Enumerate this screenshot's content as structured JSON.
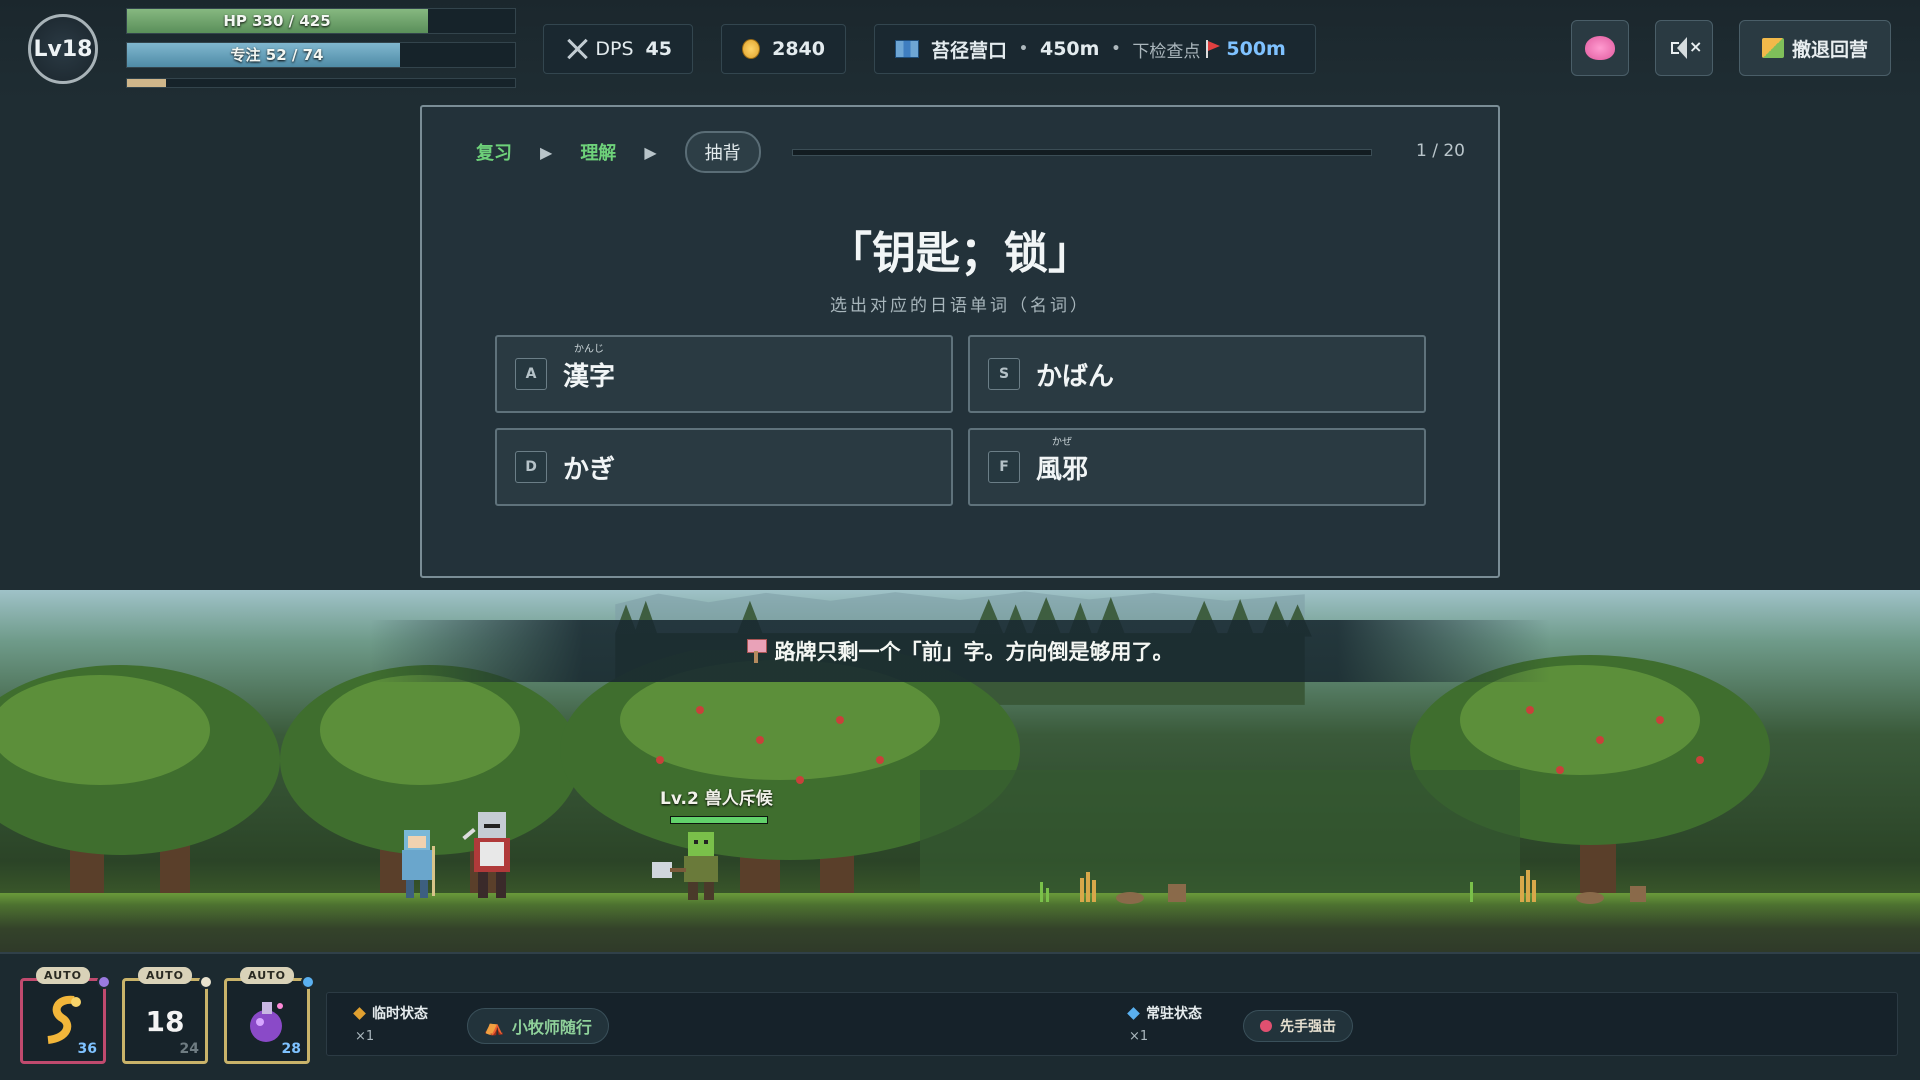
{
  "player": {
    "level": "Lv18",
    "hp_text": "HP 330 / 425",
    "hp_fraction": 0.776,
    "focus_text": "专注 52 / 74",
    "focus_fraction": 0.703,
    "xp_fraction": 0.1
  },
  "hud": {
    "dps_label": "DPS",
    "dps_value": "45",
    "gold": "2840",
    "location": "苔径营口",
    "distance": "450m",
    "next_checkpoint_label": "下检查点",
    "next_checkpoint_distance": "500m",
    "retreat_label": "撤退回营",
    "icons": {
      "dps": "crossed-swords-icon",
      "gold": "coin-icon",
      "location": "map-icon",
      "checkpoint": "red-flag-icon",
      "brain": "brain-icon",
      "mute": "speaker-muted-icon",
      "retreat": "camp-icon"
    }
  },
  "quiz": {
    "steps": [
      {
        "label": "复习",
        "state": "done"
      },
      {
        "label": "理解",
        "state": "done"
      },
      {
        "label": "抽背",
        "state": "active"
      }
    ],
    "counter": "1 / 20",
    "progress_fraction": 0.0,
    "prompt": "「钥匙；锁」",
    "hint": "选出对应的日语单词（名词）",
    "options": [
      {
        "key": "A",
        "word": "漢字",
        "furigana": "かんじ"
      },
      {
        "key": "S",
        "word": "かばん",
        "furigana": ""
      },
      {
        "key": "D",
        "word": "かぎ",
        "furigana": ""
      },
      {
        "key": "F",
        "word": "風邪",
        "furigana": "かぜ"
      }
    ]
  },
  "scene": {
    "banner_text": "路牌只剩一个「前」字。方向倒是够用了。",
    "enemy_name": "Lv.2 兽人斥候",
    "enemy_hp_fraction": 1.0
  },
  "skills": [
    {
      "tag": "AUTO",
      "cost": "36",
      "cost_color": "#7fc2ff",
      "dot_color": "#9a7ae0",
      "icon": "golden-serpent-icon",
      "cooldown": ""
    },
    {
      "tag": "AUTO",
      "cost": "24",
      "cost_color": "#6f7c82",
      "dot_color": "#e9e3cf",
      "icon": "moon-bottle-icon",
      "cooldown": "18"
    },
    {
      "tag": "AUTO",
      "cost": "28",
      "cost_color": "#7fc2ff",
      "dot_color": "#5ab0f0",
      "icon": "purple-potion-icon",
      "cooldown": ""
    }
  ],
  "status": {
    "temporary_label": "临时状态",
    "temporary_count": "×1",
    "temporary_chip": "小牧师随行",
    "permanent_label": "常驻状态",
    "permanent_count": "×1",
    "permanent_chip": "先手强击"
  },
  "colors": {
    "accent_green": "#6ed27a",
    "accent_blue": "#7fc2ff",
    "hp_green": "#86b880",
    "focus_blue": "#80b7cf",
    "gold_diamond": "#e0a030",
    "blue_diamond": "#5ab0f0"
  }
}
